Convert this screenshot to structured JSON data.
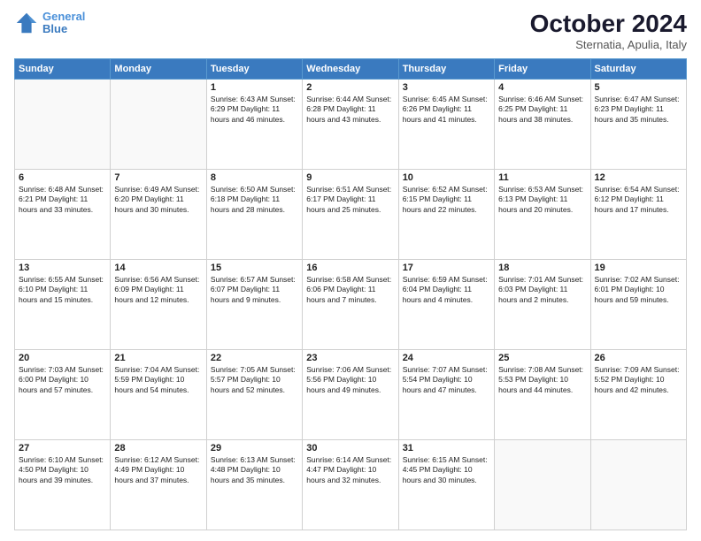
{
  "header": {
    "logo_line1": "General",
    "logo_line2": "Blue",
    "month": "October 2024",
    "location": "Sternatia, Apulia, Italy"
  },
  "weekdays": [
    "Sunday",
    "Monday",
    "Tuesday",
    "Wednesday",
    "Thursday",
    "Friday",
    "Saturday"
  ],
  "weeks": [
    [
      {
        "day": "",
        "text": ""
      },
      {
        "day": "",
        "text": ""
      },
      {
        "day": "1",
        "text": "Sunrise: 6:43 AM\nSunset: 6:29 PM\nDaylight: 11 hours\nand 46 minutes."
      },
      {
        "day": "2",
        "text": "Sunrise: 6:44 AM\nSunset: 6:28 PM\nDaylight: 11 hours\nand 43 minutes."
      },
      {
        "day": "3",
        "text": "Sunrise: 6:45 AM\nSunset: 6:26 PM\nDaylight: 11 hours\nand 41 minutes."
      },
      {
        "day": "4",
        "text": "Sunrise: 6:46 AM\nSunset: 6:25 PM\nDaylight: 11 hours\nand 38 minutes."
      },
      {
        "day": "5",
        "text": "Sunrise: 6:47 AM\nSunset: 6:23 PM\nDaylight: 11 hours\nand 35 minutes."
      }
    ],
    [
      {
        "day": "6",
        "text": "Sunrise: 6:48 AM\nSunset: 6:21 PM\nDaylight: 11 hours\nand 33 minutes."
      },
      {
        "day": "7",
        "text": "Sunrise: 6:49 AM\nSunset: 6:20 PM\nDaylight: 11 hours\nand 30 minutes."
      },
      {
        "day": "8",
        "text": "Sunrise: 6:50 AM\nSunset: 6:18 PM\nDaylight: 11 hours\nand 28 minutes."
      },
      {
        "day": "9",
        "text": "Sunrise: 6:51 AM\nSunset: 6:17 PM\nDaylight: 11 hours\nand 25 minutes."
      },
      {
        "day": "10",
        "text": "Sunrise: 6:52 AM\nSunset: 6:15 PM\nDaylight: 11 hours\nand 22 minutes."
      },
      {
        "day": "11",
        "text": "Sunrise: 6:53 AM\nSunset: 6:13 PM\nDaylight: 11 hours\nand 20 minutes."
      },
      {
        "day": "12",
        "text": "Sunrise: 6:54 AM\nSunset: 6:12 PM\nDaylight: 11 hours\nand 17 minutes."
      }
    ],
    [
      {
        "day": "13",
        "text": "Sunrise: 6:55 AM\nSunset: 6:10 PM\nDaylight: 11 hours\nand 15 minutes."
      },
      {
        "day": "14",
        "text": "Sunrise: 6:56 AM\nSunset: 6:09 PM\nDaylight: 11 hours\nand 12 minutes."
      },
      {
        "day": "15",
        "text": "Sunrise: 6:57 AM\nSunset: 6:07 PM\nDaylight: 11 hours\nand 9 minutes."
      },
      {
        "day": "16",
        "text": "Sunrise: 6:58 AM\nSunset: 6:06 PM\nDaylight: 11 hours\nand 7 minutes."
      },
      {
        "day": "17",
        "text": "Sunrise: 6:59 AM\nSunset: 6:04 PM\nDaylight: 11 hours\nand 4 minutes."
      },
      {
        "day": "18",
        "text": "Sunrise: 7:01 AM\nSunset: 6:03 PM\nDaylight: 11 hours\nand 2 minutes."
      },
      {
        "day": "19",
        "text": "Sunrise: 7:02 AM\nSunset: 6:01 PM\nDaylight: 10 hours\nand 59 minutes."
      }
    ],
    [
      {
        "day": "20",
        "text": "Sunrise: 7:03 AM\nSunset: 6:00 PM\nDaylight: 10 hours\nand 57 minutes."
      },
      {
        "day": "21",
        "text": "Sunrise: 7:04 AM\nSunset: 5:59 PM\nDaylight: 10 hours\nand 54 minutes."
      },
      {
        "day": "22",
        "text": "Sunrise: 7:05 AM\nSunset: 5:57 PM\nDaylight: 10 hours\nand 52 minutes."
      },
      {
        "day": "23",
        "text": "Sunrise: 7:06 AM\nSunset: 5:56 PM\nDaylight: 10 hours\nand 49 minutes."
      },
      {
        "day": "24",
        "text": "Sunrise: 7:07 AM\nSunset: 5:54 PM\nDaylight: 10 hours\nand 47 minutes."
      },
      {
        "day": "25",
        "text": "Sunrise: 7:08 AM\nSunset: 5:53 PM\nDaylight: 10 hours\nand 44 minutes."
      },
      {
        "day": "26",
        "text": "Sunrise: 7:09 AM\nSunset: 5:52 PM\nDaylight: 10 hours\nand 42 minutes."
      }
    ],
    [
      {
        "day": "27",
        "text": "Sunrise: 6:10 AM\nSunset: 4:50 PM\nDaylight: 10 hours\nand 39 minutes."
      },
      {
        "day": "28",
        "text": "Sunrise: 6:12 AM\nSunset: 4:49 PM\nDaylight: 10 hours\nand 37 minutes."
      },
      {
        "day": "29",
        "text": "Sunrise: 6:13 AM\nSunset: 4:48 PM\nDaylight: 10 hours\nand 35 minutes."
      },
      {
        "day": "30",
        "text": "Sunrise: 6:14 AM\nSunset: 4:47 PM\nDaylight: 10 hours\nand 32 minutes."
      },
      {
        "day": "31",
        "text": "Sunrise: 6:15 AM\nSunset: 4:45 PM\nDaylight: 10 hours\nand 30 minutes."
      },
      {
        "day": "",
        "text": ""
      },
      {
        "day": "",
        "text": ""
      }
    ]
  ]
}
